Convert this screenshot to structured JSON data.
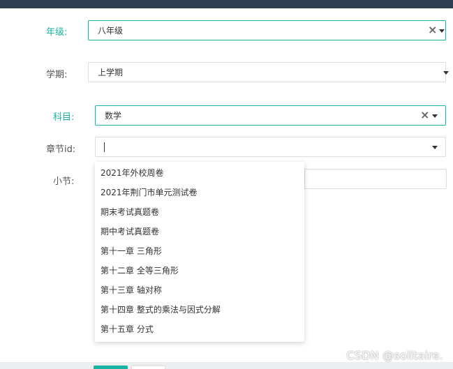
{
  "form": {
    "grade": {
      "label": "年级:",
      "value": "八年级"
    },
    "term": {
      "label": "学期:",
      "value": "上学期"
    },
    "subject": {
      "label": "科目:",
      "value": "数学"
    },
    "chapter": {
      "label": "章节id:",
      "value": ""
    },
    "section": {
      "label": "小节:",
      "value": ""
    }
  },
  "dropdown": {
    "options": [
      "2021年外校周卷",
      "2021年荆门市单元测试卷",
      "期末考试真题卷",
      "期中考试真题卷",
      "第十一章 三角形",
      "第十二章 全等三角形",
      "第十三章 轴对称",
      "第十四章 整式的乘法与因式分解",
      "第十五章 分式"
    ]
  },
  "icons": {
    "clear": "×",
    "dropdown_arrow": "caret-down"
  },
  "colors": {
    "accent": "#17b3a3",
    "header": "#2e3e52",
    "text": "#333333"
  },
  "watermark": "CSDN @solitaire."
}
